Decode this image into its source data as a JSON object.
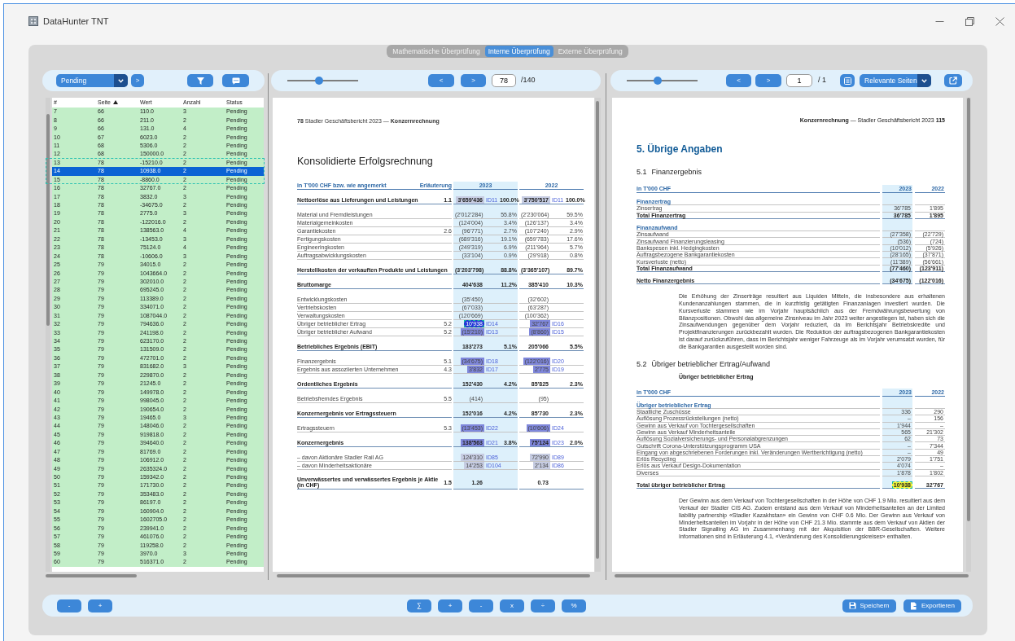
{
  "window": {
    "title": "DataHunter TNT"
  },
  "mode_tabs": [
    {
      "label": "Mathematische Überprüfung",
      "selected": false
    },
    {
      "label": "Interne Überprüfung",
      "selected": true
    },
    {
      "label": "Externe Überprüfung",
      "selected": false
    }
  ],
  "review_panel": {
    "status_filter": "Pending",
    "next_button": ">",
    "table": {
      "columns": [
        {
          "label": "#"
        },
        {
          "label": "Seite",
          "sorted_ascending": true
        },
        {
          "label": "Wert"
        },
        {
          "label": "Anzahl"
        },
        {
          "label": "Status"
        }
      ],
      "rows": [
        {
          "cells": [
            "7",
            "66",
            "110.0",
            "3",
            "Pending"
          ],
          "selected": false
        },
        {
          "cells": [
            "8",
            "66",
            "211.0",
            "2",
            "Pending"
          ],
          "selected": false
        },
        {
          "cells": [
            "9",
            "66",
            "131.0",
            "4",
            "Pending"
          ],
          "selected": false
        },
        {
          "cells": [
            "10",
            "67",
            "6023.0",
            "2",
            "Pending"
          ],
          "selected": false
        },
        {
          "cells": [
            "11",
            "68",
            "5306.0",
            "2",
            "Pending"
          ],
          "selected": false
        },
        {
          "cells": [
            "12",
            "68",
            "150000.0",
            "2",
            "Pending"
          ],
          "selected": false
        },
        {
          "cells": [
            "13",
            "78",
            "-15210.0",
            "2",
            "Pending"
          ],
          "selected": false
        },
        {
          "cells": [
            "14",
            "78",
            "10938.0",
            "2",
            "Pending"
          ],
          "selected": true
        },
        {
          "cells": [
            "15",
            "78",
            "-8860.0",
            "2",
            "Pending"
          ],
          "selected": false
        },
        {
          "cells": [
            "16",
            "78",
            "32767.0",
            "2",
            "Pending"
          ],
          "selected": false
        },
        {
          "cells": [
            "17",
            "78",
            "3832.0",
            "3",
            "Pending"
          ],
          "selected": false
        },
        {
          "cells": [
            "18",
            "78",
            "-34675.0",
            "2",
            "Pending"
          ],
          "selected": false
        },
        {
          "cells": [
            "19",
            "78",
            "2775.0",
            "3",
            "Pending"
          ],
          "selected": false
        },
        {
          "cells": [
            "20",
            "78",
            "-122016.0",
            "2",
            "Pending"
          ],
          "selected": false
        },
        {
          "cells": [
            "21",
            "78",
            "138563.0",
            "4",
            "Pending"
          ],
          "selected": false
        },
        {
          "cells": [
            "22",
            "78",
            "-13453.0",
            "3",
            "Pending"
          ],
          "selected": false
        },
        {
          "cells": [
            "23",
            "78",
            "75124.0",
            "4",
            "Pending"
          ],
          "selected": false
        },
        {
          "cells": [
            "24",
            "78",
            "-10606.0",
            "3",
            "Pending"
          ],
          "selected": false
        },
        {
          "cells": [
            "25",
            "79",
            "34015.0",
            "2",
            "Pending"
          ],
          "selected": false
        },
        {
          "cells": [
            "26",
            "79",
            "1043664.0",
            "2",
            "Pending"
          ],
          "selected": false
        },
        {
          "cells": [
            "27",
            "79",
            "302010.0",
            "2",
            "Pending"
          ],
          "selected": false
        },
        {
          "cells": [
            "28",
            "79",
            "695245.0",
            "2",
            "Pending"
          ],
          "selected": false
        },
        {
          "cells": [
            "29",
            "79",
            "113389.0",
            "2",
            "Pending"
          ],
          "selected": false
        },
        {
          "cells": [
            "30",
            "79",
            "334071.0",
            "2",
            "Pending"
          ],
          "selected": false
        },
        {
          "cells": [
            "31",
            "79",
            "1087044.0",
            "2",
            "Pending"
          ],
          "selected": false
        },
        {
          "cells": [
            "32",
            "79",
            "794636.0",
            "2",
            "Pending"
          ],
          "selected": false
        },
        {
          "cells": [
            "33",
            "79",
            "241198.0",
            "2",
            "Pending"
          ],
          "selected": false
        },
        {
          "cells": [
            "34",
            "79",
            "623170.0",
            "2",
            "Pending"
          ],
          "selected": false
        },
        {
          "cells": [
            "35",
            "79",
            "131509.0",
            "2",
            "Pending"
          ],
          "selected": false
        },
        {
          "cells": [
            "36",
            "79",
            "472701.0",
            "2",
            "Pending"
          ],
          "selected": false
        },
        {
          "cells": [
            "37",
            "79",
            "831682.0",
            "3",
            "Pending"
          ],
          "selected": false
        },
        {
          "cells": [
            "38",
            "79",
            "229870.0",
            "2",
            "Pending"
          ],
          "selected": false
        },
        {
          "cells": [
            "39",
            "79",
            "21245.0",
            "2",
            "Pending"
          ],
          "selected": false
        },
        {
          "cells": [
            "40",
            "79",
            "149978.0",
            "2",
            "Pending"
          ],
          "selected": false
        },
        {
          "cells": [
            "41",
            "79",
            "998045.0",
            "2",
            "Pending"
          ],
          "selected": false
        },
        {
          "cells": [
            "42",
            "79",
            "190654.0",
            "2",
            "Pending"
          ],
          "selected": false
        },
        {
          "cells": [
            "43",
            "79",
            "19465.0",
            "3",
            "Pending"
          ],
          "selected": false
        },
        {
          "cells": [
            "44",
            "79",
            "148046.0",
            "2",
            "Pending"
          ],
          "selected": false
        },
        {
          "cells": [
            "45",
            "79",
            "919818.0",
            "2",
            "Pending"
          ],
          "selected": false
        },
        {
          "cells": [
            "46",
            "79",
            "394640.0",
            "2",
            "Pending"
          ],
          "selected": false
        },
        {
          "cells": [
            "47",
            "79",
            "81769.0",
            "2",
            "Pending"
          ],
          "selected": false
        },
        {
          "cells": [
            "48",
            "79",
            "106912.0",
            "2",
            "Pending"
          ],
          "selected": false
        },
        {
          "cells": [
            "49",
            "79",
            "2635324.0",
            "2",
            "Pending"
          ],
          "selected": false
        },
        {
          "cells": [
            "50",
            "79",
            "159342.0",
            "2",
            "Pending"
          ],
          "selected": false
        },
        {
          "cells": [
            "51",
            "79",
            "171730.0",
            "2",
            "Pending"
          ],
          "selected": false
        },
        {
          "cells": [
            "52",
            "79",
            "353483.0",
            "2",
            "Pending"
          ],
          "selected": false
        },
        {
          "cells": [
            "53",
            "79",
            "86197.0",
            "2",
            "Pending"
          ],
          "selected": false
        },
        {
          "cells": [
            "54",
            "79",
            "160904.0",
            "2",
            "Pending"
          ],
          "selected": false
        },
        {
          "cells": [
            "55",
            "79",
            "1602705.0",
            "2",
            "Pending"
          ],
          "selected": false
        },
        {
          "cells": [
            "56",
            "79",
            "239941.0",
            "2",
            "Pending"
          ],
          "selected": false
        },
        {
          "cells": [
            "57",
            "79",
            "461076.0",
            "2",
            "Pending"
          ],
          "selected": false
        },
        {
          "cells": [
            "58",
            "79",
            "119258.0",
            "2",
            "Pending"
          ],
          "selected": false
        },
        {
          "cells": [
            "59",
            "79",
            "3970.0",
            "3",
            "Pending"
          ],
          "selected": false
        },
        {
          "cells": [
            "60",
            "79",
            "516371.0",
            "2",
            "Pending"
          ],
          "selected": false
        }
      ]
    }
  },
  "source_viewer": {
    "zoom": {
      "level": 0.45
    },
    "prev_button": "<",
    "next_button": ">",
    "page": "78",
    "page_total": "/140",
    "document": {
      "running_header": "**78** Stadler Geschäftsbericht 2023 — **Konzernrechnung**",
      "title": "Konsolidierte Erfolgsrechnung",
      "table": {
        "header": {
          "label": "in T'000 CHF bzw. wie angemerkt",
          "note": "Erläuterung",
          "columns": [
            "2023",
            "2022"
          ]
        },
        "sections": [
          {
            "rows": [
              {
                "label": "Nettoerlöse aus Lieferungen und Leistungen",
                "note": "1.1",
                "kind": "total",
                "y2023": {
                  "value": "3'659'436",
                  "tag": "ID11",
                  "pct": "100.0%",
                  "color": "#c6cce2",
                  "selected": false
                },
                "y2022": {
                  "value": "3'750'517",
                  "tag": "ID11",
                  "pct": "100.0%",
                  "color": "#c6cce2",
                  "selected": false
                }
              }
            ]
          },
          {
            "rows": [
              {
                "label": "Material und Fremdleistungen",
                "kind": "line",
                "y2023": {
                  "value": "(2'012'284)",
                  "pct": "55.8%"
                },
                "y2022": {
                  "value": "(2'230'064)",
                  "pct": "59.5%"
                }
              },
              {
                "label": "Materialgemeinkosten",
                "kind": "line",
                "y2023": {
                  "value": "(124'004)",
                  "pct": "3.4%"
                },
                "y2022": {
                  "value": "(126'137)",
                  "pct": "3.4%"
                }
              },
              {
                "label": "Garantiekosten",
                "note": "2.6",
                "kind": "line",
                "y2023": {
                  "value": "(96'771)",
                  "pct": "2.7%"
                },
                "y2022": {
                  "value": "(107'240)",
                  "pct": "2.9%"
                }
              },
              {
                "label": "Fertigungskosten",
                "kind": "line",
                "y2023": {
                  "value": "(689'316)",
                  "pct": "19.1%"
                },
                "y2022": {
                  "value": "(659'783)",
                  "pct": "17.6%"
                }
              },
              {
                "label": "Engineeringkosten",
                "kind": "line",
                "y2023": {
                  "value": "(249'319)",
                  "pct": "6.9%"
                },
                "y2022": {
                  "value": "(211'964)",
                  "pct": "5.7%"
                }
              },
              {
                "label": "Auftragsabwicklungskosten",
                "kind": "line",
                "y2023": {
                  "value": "(33'104)",
                  "pct": "0.9%"
                },
                "y2022": {
                  "value": "(29'918)",
                  "pct": "0.8%"
                }
              }
            ]
          },
          {
            "rows": [
              {
                "label": "Herstellkosten der verkauften Produkte und Leistungen",
                "kind": "total",
                "y2023": {
                  "value": "(3'203'798)",
                  "pct": "88.8%"
                },
                "y2022": {
                  "value": "(3'365'107)",
                  "pct": "89.7%"
                }
              }
            ]
          },
          {
            "rows": [
              {
                "label": "Bruttomarge",
                "kind": "total",
                "y2023": {
                  "value": "404'638",
                  "pct": "11.2%"
                },
                "y2022": {
                  "value": "385'410",
                  "pct": "10.3%"
                }
              }
            ]
          },
          {
            "rows": [
              {
                "label": "Entwicklungskosten",
                "kind": "line",
                "y2023": {
                  "value": "(35'450)"
                },
                "y2022": {
                  "value": "(32'602)"
                }
              },
              {
                "label": "Vertriebskosten",
                "kind": "line",
                "y2023": {
                  "value": "(67'033)"
                },
                "y2022": {
                  "value": "(63'287)"
                }
              },
              {
                "label": "Verwaltungskosten",
                "kind": "line",
                "y2023": {
                  "value": "(120'669)"
                },
                "y2022": {
                  "value": "(100'362)"
                }
              },
              {
                "label": "Übriger betrieblicher Ertrag",
                "note": "5.2",
                "kind": "line",
                "y2023": {
                  "value": "10'938",
                  "tag": "ID14",
                  "color": "#2438d6",
                  "selected": true
                },
                "y2022": {
                  "value": "32'767",
                  "tag": "ID16",
                  "color": "#7f87db",
                  "selected": false
                }
              },
              {
                "label": "Übriger betrieblicher Aufwand",
                "note": "5.2",
                "kind": "line",
                "y2023": {
                  "value": "(15'210)",
                  "tag": "ID13",
                  "color": "#7f87db",
                  "selected": false
                },
                "y2022": {
                  "value": "(8'860)",
                  "tag": "ID15",
                  "color": "#7f87db",
                  "selected": false
                }
              }
            ]
          },
          {
            "rows": [
              {
                "label": "Betriebliches Ergebnis (EBIT)",
                "kind": "total",
                "y2023": {
                  "value": "183'273",
                  "pct": "5.1%"
                },
                "y2022": {
                  "value": "205'066",
                  "pct": "5.5%"
                }
              }
            ]
          },
          {
            "rows": [
              {
                "label": "Finanzergebnis",
                "note": "5.1",
                "kind": "line",
                "y2023": {
                  "value": "(34'675)",
                  "tag": "ID18",
                  "color": "#7f87db",
                  "selected": false
                },
                "y2022": {
                  "value": "(122'016)",
                  "tag": "ID20",
                  "color": "#7f87db",
                  "selected": false
                }
              },
              {
                "label": "Ergebnis aus assoziierten Unternehmen",
                "note": "4.3",
                "kind": "line",
                "y2023": {
                  "value": "3'832",
                  "tag": "ID17",
                  "color": "#7f87db",
                  "selected": false
                },
                "y2022": {
                  "value": "2'775",
                  "tag": "ID19",
                  "color": "#7f87db",
                  "selected": false
                }
              }
            ]
          },
          {
            "rows": [
              {
                "label": "Ordentliches Ergebnis",
                "kind": "total",
                "y2023": {
                  "value": "152'430",
                  "pct": "4.2%"
                },
                "y2022": {
                  "value": "85'825",
                  "pct": "2.3%"
                }
              }
            ]
          },
          {
            "rows": [
              {
                "label": "Betriebsfremdes Ergebnis",
                "note": "5.5",
                "kind": "line",
                "y2023": {
                  "value": "(414)"
                },
                "y2022": {
                  "value": "(95)"
                }
              }
            ]
          },
          {
            "rows": [
              {
                "label": "Konzernergebnis vor Ertragssteuern",
                "kind": "total",
                "y2023": {
                  "value": "152'016",
                  "pct": "4.2%"
                },
                "y2022": {
                  "value": "85'730",
                  "pct": "2.3%"
                }
              }
            ]
          },
          {
            "rows": [
              {
                "label": "Ertragssteuern",
                "note": "5.3",
                "kind": "line",
                "y2023": {
                  "value": "(13'453)",
                  "tag": "ID22",
                  "color": "#7f87db",
                  "selected": false
                },
                "y2022": {
                  "value": "(10'606)",
                  "tag": "ID24",
                  "color": "#7f87db",
                  "selected": false
                }
              }
            ]
          },
          {
            "rows": [
              {
                "label": "Konzernergebnis",
                "kind": "total",
                "y2023": {
                  "value": "138'563",
                  "tag": "ID21",
                  "pct": "3.8%",
                  "color": "#7f87db",
                  "selected": false
                },
                "y2022": {
                  "value": "75'124",
                  "tag": "ID23",
                  "pct": "2.0%",
                  "color": "#7f87db",
                  "selected": false
                }
              }
            ]
          },
          {
            "rows": [
              {
                "label": "– davon Aktionäre Stadler Rail AG",
                "kind": "line",
                "y2023": {
                  "value": "124'310",
                  "tag": "ID85",
                  "color": "#c6cce2",
                  "selected": false
                },
                "y2022": {
                  "value": "72'990",
                  "tag": "ID89",
                  "color": "#c6cce2",
                  "selected": false
                }
              },
              {
                "label": "– davon Minderheitsaktionäre",
                "kind": "line",
                "y2023": {
                  "value": "14'253",
                  "tag": "ID104",
                  "color": "#c6cce2",
                  "selected": false
                },
                "y2022": {
                  "value": "2'134",
                  "tag": "ID86",
                  "color": "#c6cce2",
                  "selected": false
                }
              }
            ]
          },
          {
            "rows": [
              {
                "label": "Unverwässertes und verwässertes Ergebnis je Aktie (in CHF)",
                "note": "1.5",
                "kind": "total",
                "y2023": {
                  "value": "1.26"
                },
                "y2022": {
                  "value": "0.73"
                }
              }
            ]
          }
        ]
      }
    }
  },
  "target_viewer": {
    "zoom": {
      "level": 0.44
    },
    "prev_button": "<",
    "next_button": ">",
    "page": "1",
    "page_total": "/ 1",
    "page_filter": "Relevante Seiten",
    "document": {
      "running_header": "**Konzernrechnung** — Stadler Geschäftsbericht 2023 **115**",
      "title": "5. Übrige Angaben",
      "blocks": [
        {
          "kind": "heading",
          "number": "5.1",
          "title": "Finanzergebnis"
        },
        {
          "kind": "table",
          "header": {
            "label": "in T'000 CHF",
            "columns": [
              "2023",
              "2022"
            ]
          },
          "sections": [
            {
              "rows": [
                {
                  "label": "Finanzertrag",
                  "kind": "heading"
                },
                {
                  "label": "Zinsertrag",
                  "kind": "line",
                  "values": [
                    "36'785",
                    "1'895"
                  ]
                },
                {
                  "label": "Total Finanzertrag",
                  "kind": "total",
                  "values": [
                    "36'785",
                    "1'895"
                  ]
                }
              ]
            },
            {
              "rows": [
                {
                  "label": "Finanzaufwand",
                  "kind": "heading"
                },
                {
                  "label": "Zinsaufwand",
                  "kind": "line",
                  "values": [
                    "(27'358)",
                    "(22'729)"
                  ]
                },
                {
                  "label": "Zinsaufwand Finanzierungsleasing",
                  "kind": "line",
                  "values": [
                    "(536)",
                    "(724)"
                  ]
                },
                {
                  "label": "Bankspesen inkl. Hedgingkosten",
                  "kind": "line",
                  "values": [
                    "(10'012)",
                    "(5'926)"
                  ]
                },
                {
                  "label": "Auftragsbezogene Bankgarantiekosten",
                  "kind": "line",
                  "values": [
                    "(28'165)",
                    "(37'871)"
                  ]
                },
                {
                  "label": "Kursverluste (netto)",
                  "kind": "line",
                  "values": [
                    "(11'389)",
                    "(56'661)"
                  ]
                },
                {
                  "label": "Total Finanzaufwand",
                  "kind": "total",
                  "values": [
                    "(77'460)",
                    "(123'911)"
                  ]
                }
              ]
            },
            {
              "rows": [
                {
                  "label": "Netto Finanzergebnis",
                  "kind": "total",
                  "values": [
                    "(34'675)",
                    "(122'016)"
                  ]
                }
              ]
            }
          ]
        },
        {
          "kind": "paragraph",
          "text": "Die Erhöhung der Zinserträge resultiert aus Liquiden Mitteln, die insbesondere aus erhaltenen Kundenanzahlungen stammen, die in kurzfristig getätigten Finanzanlagen investiert wurden. Die Kursverluste stammen wie im Vorjahr hauptsächlich aus der Fremdwährungsbewertung von Bilanzpositionen. Obwohl das allgemeine Zinsniveau im Jahr 2023 weiter angestiegen ist, haben sich die Zinsaufwendungen gegenüber dem Vorjahr reduziert, da im Berichtsjahr Betriebskredite und Projektfinanzierungen zurückbezahlt wurden. Die Reduktion der auftragsbezogenen Bankgarantiekosten ist darauf zurückzuführen, dass im Berichtsjahr weniger Fahrzeuge als im Vorjahr verumsatzt wurden, für die Bankgarantien ausgestellt worden sind."
        },
        {
          "kind": "heading",
          "number": "5.2",
          "title": "Übriger betrieblicher Ertrag/Aufwand"
        },
        {
          "kind": "subheading",
          "text": "Übriger betrieblicher Ertrag"
        },
        {
          "kind": "table",
          "header": {
            "label": "in T'000 CHF",
            "columns": [
              "2023",
              "2022"
            ]
          },
          "sections": [
            {
              "rows": [
                {
                  "label": "Übriger betrieblicher Ertrag",
                  "kind": "heading"
                },
                {
                  "label": "Staatliche Zuschüsse",
                  "kind": "line",
                  "values": [
                    "336",
                    "290"
                  ]
                },
                {
                  "label": "Auflösung Prozessrückstellungen (netto)",
                  "kind": "line",
                  "values": [
                    "–",
                    "156"
                  ]
                },
                {
                  "label": "Gewinn aus Verkauf von Tochtergesellschaften",
                  "kind": "line",
                  "values": [
                    "1'944",
                    "–"
                  ]
                },
                {
                  "label": "Gewinn aus Verkauf Minderheitsanteile",
                  "kind": "line",
                  "values": [
                    "565",
                    "21'302"
                  ]
                },
                {
                  "label": "Auflösung Sozialversicherungs- und Personalabgrenzungen",
                  "kind": "line",
                  "values": [
                    "62",
                    "73"
                  ]
                },
                {
                  "label": "Gutschrift Corona-Unterstützungsprogramm USA",
                  "kind": "line",
                  "values": [
                    "–",
                    "7'344"
                  ]
                },
                {
                  "label": "Eingang von abgeschriebenen Forderungen inkl. Veränderungen Wertberichtigung (netto)",
                  "kind": "line",
                  "values": [
                    "–",
                    "49"
                  ]
                },
                {
                  "label": "Erlös Recycling",
                  "kind": "line",
                  "values": [
                    "2'079",
                    "1'751"
                  ]
                },
                {
                  "label": "Erlös aus Verkauf Design-Dokumentation",
                  "kind": "line",
                  "values": [
                    "4'074",
                    "–"
                  ]
                },
                {
                  "label": "Diverses",
                  "kind": "line",
                  "values": [
                    "1'878",
                    "1'802"
                  ]
                }
              ]
            },
            {
              "rows": [
                {
                  "label": "Total übriger betrieblicher Ertrag",
                  "kind": "total",
                  "values": [
                    "10'938",
                    "32'767"
                  ],
                  "highlight_2023": {
                    "color": "#eef23a",
                    "selected": true
                  }
                }
              ]
            }
          ]
        },
        {
          "kind": "paragraph",
          "text": "Der Gewinn aus dem Verkauf von Tochtergesellschaften in der Höhe von CHF 1.9 Mio. resultiert aus dem Verkauf der Stadler CIS AG. Zudem entstand aus dem Verkauf von Minderheitsanteilen an der Limited liability partnership «Stadler Kazakhstan» ein Gewinn von CHF 0.6 Mio. Der Gewinn aus Verkauf von Minderheitsanteilen im Vorjahr in der Höhe von CHF 21.3 Mio. stammte aus dem Verkauf von Aktien der Stadler Signalling AG im Zusammenhang mit der Akquisition der BBR-Gesellschaften. Weitere Informationen sind in Erläuterung 4.1, «Veränderung des Konsolidierungskreises» enthalten."
        }
      ]
    }
  },
  "bottom_toolbar": {
    "left_buttons": [
      "-",
      "+"
    ],
    "operator_buttons": [
      "∑",
      "+",
      "-",
      "x",
      "÷",
      "%"
    ],
    "save_button": "Speichern",
    "export_button": "Exportieren"
  }
}
